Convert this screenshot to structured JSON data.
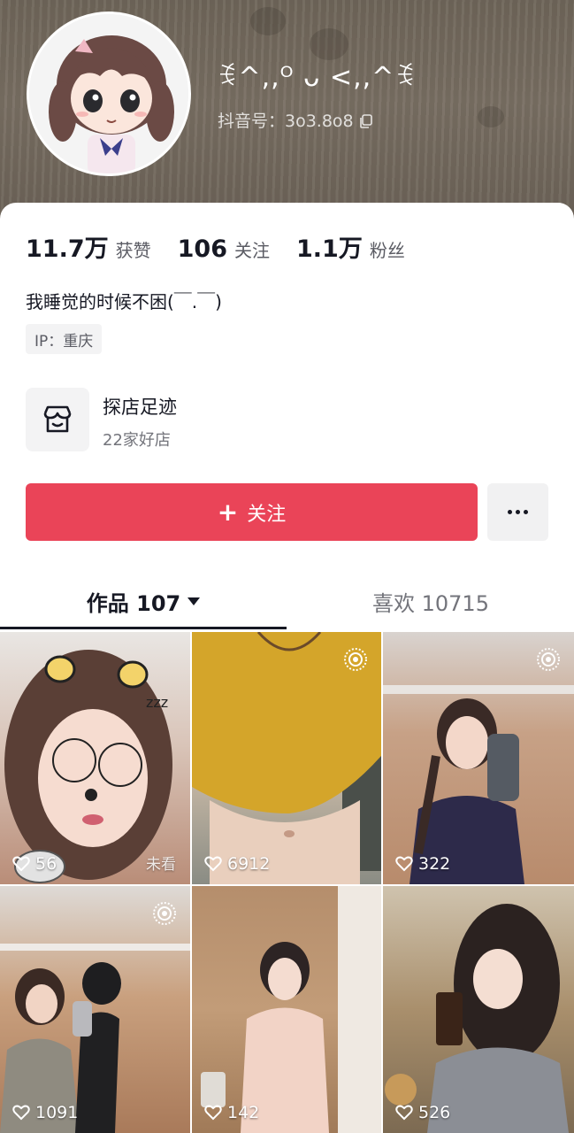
{
  "profile": {
    "nickname": "ꉂ^,,ᴼ ᴗ <,,^ꉂ",
    "douyin_id": "抖音号：3o3.8o8"
  },
  "stats": {
    "likes_value": "11.7万",
    "likes_label": "获赞",
    "following_value": "106",
    "following_label": "关注",
    "followers_value": "1.1万",
    "followers_label": "粉丝"
  },
  "bio": "我睡觉的时候不困(￣.￣)",
  "ip_location": "IP：重庆",
  "shop": {
    "title": "探店足迹",
    "subtitle": "22家好店"
  },
  "actions": {
    "follow_label": "关注",
    "plus_symbol": "+"
  },
  "tabs": {
    "works_label": "作品 107",
    "likes_label": "喜欢 10715"
  },
  "videos": [
    {
      "likes": "56",
      "badge": "未看",
      "live": false
    },
    {
      "likes": "6912",
      "badge": "",
      "live": true
    },
    {
      "likes": "322",
      "badge": "",
      "live": true
    },
    {
      "likes": "1091",
      "badge": "",
      "live": true
    },
    {
      "likes": "142",
      "badge": "",
      "live": false
    },
    {
      "likes": "526",
      "badge": "",
      "live": false
    }
  ],
  "colors": {
    "accent": "#ea4458",
    "text_primary": "#161823",
    "text_secondary": "#73747b"
  }
}
